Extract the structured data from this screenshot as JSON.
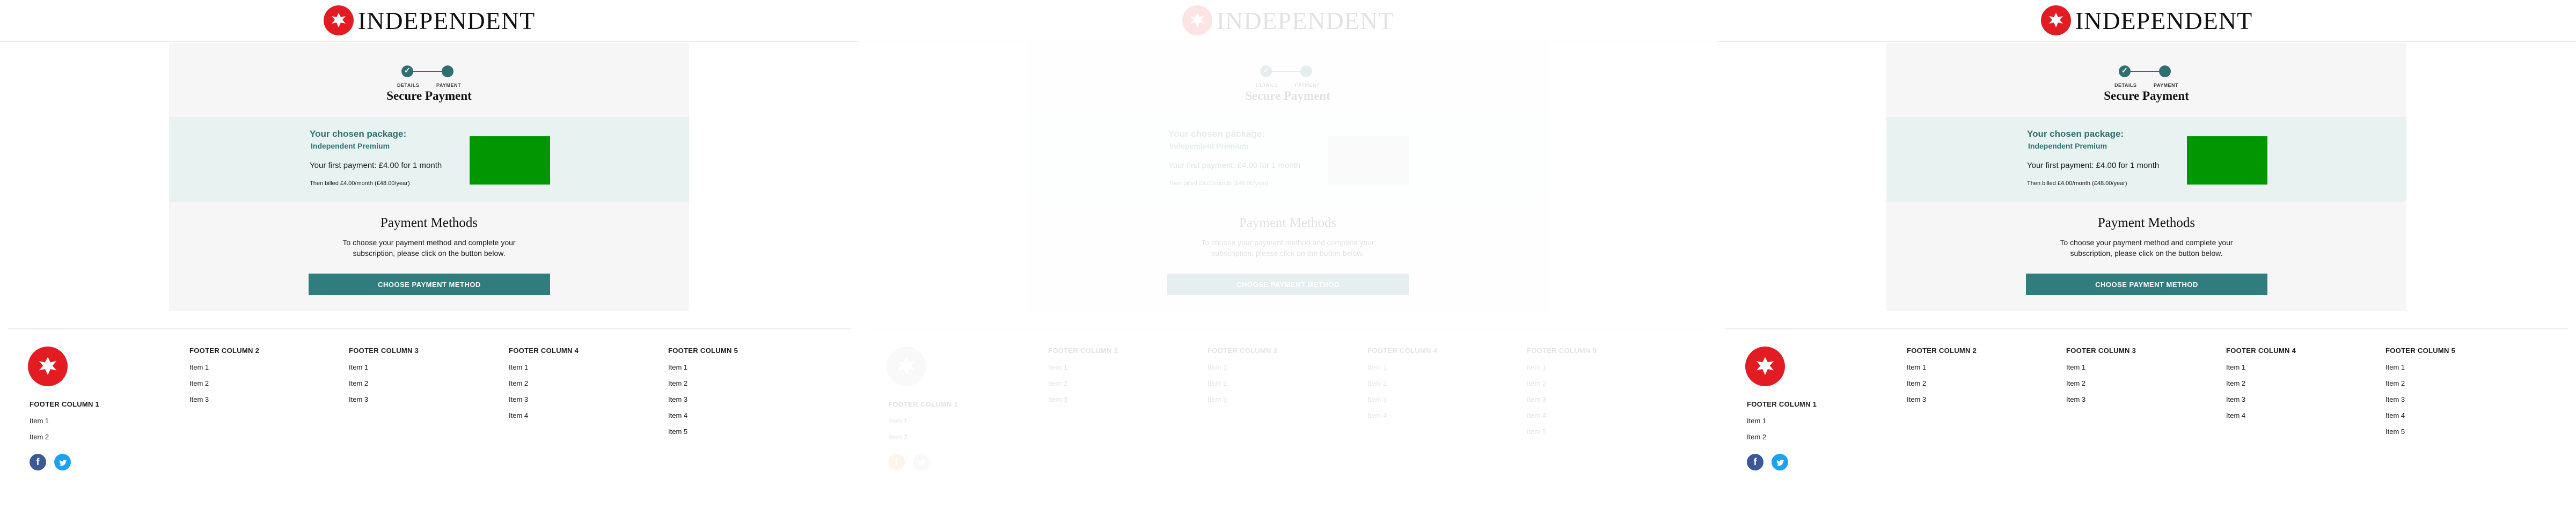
{
  "brand": {
    "logo_text": "INDEPENDENT",
    "red": "#e31b23",
    "teal": "#2f6f73",
    "button_teal": "#2f7d7d",
    "package_bg": "#e8f2f0",
    "package_box": "#029602"
  },
  "stepper": {
    "step1_label": "DETAILS",
    "step2_label": "PAYMENT"
  },
  "payment": {
    "title": "Secure Payment",
    "package_title": "Your chosen package:",
    "package_name": "Independent Premium",
    "first_payment": "Your first payment: £4.00 for 1 month",
    "then_billed": "Then billed £4.00/month (£48.00/year)"
  },
  "methods": {
    "title": "Payment Methods",
    "desc_line1": "To choose your payment method and complete your",
    "desc_line2": "subscription, please click on the button below.",
    "button_label": "CHOOSE PAYMENT METHOD"
  },
  "footer": {
    "col1": {
      "title": "FOOTER COLUMN 1",
      "items": [
        "Item 1",
        "Item 2"
      ]
    },
    "col2": {
      "title": "FOOTER COLUMN 2",
      "items": [
        "Item 1",
        "Item 2",
        "Item 3"
      ]
    },
    "col3": {
      "title": "FOOTER COLUMN 3",
      "items": [
        "Item 1",
        "Item 2",
        "Item 3"
      ]
    },
    "col4": {
      "title": "FOOTER COLUMN 4",
      "items": [
        "Item 1",
        "Item 2",
        "Item 3",
        "Item 4"
      ]
    },
    "col5": {
      "title": "FOOTER COLUMN 5",
      "items": [
        "Item 1",
        "Item 2",
        "Item 3",
        "Item 4",
        "Item 5"
      ]
    },
    "social": {
      "facebook_icon": "facebook-icon",
      "twitter_icon": "twitter-icon"
    }
  }
}
